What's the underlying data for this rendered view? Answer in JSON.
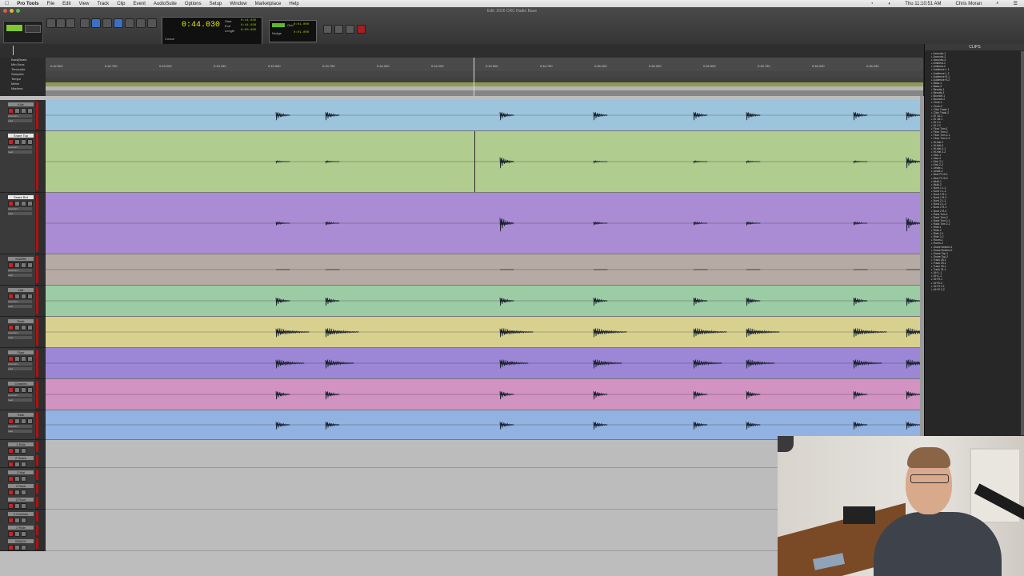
{
  "menubar": {
    "apple": "",
    "items": [
      "Pro Tools",
      "File",
      "Edit",
      "View",
      "Track",
      "Clip",
      "Event",
      "AudioSuite",
      "Options",
      "Setup",
      "Window",
      "Marketplace",
      "Help"
    ],
    "clock": "Thu 11:10:51 AM",
    "user": "Chris Moran"
  },
  "window": {
    "title": "Edit: 2016 CRC Radio Base"
  },
  "counter": {
    "main": "0:44.030",
    "label": "Cursor",
    "start": "0:44.030",
    "end": "0:44.030",
    "length": "0:00.000",
    "start_lbl": "Start",
    "end_lbl": "End",
    "length_lbl": "Length"
  },
  "grid": {
    "grid_lbl": "Grid",
    "nudge_lbl": "Nudge",
    "grid_val": "0:01.000",
    "nudge_val": "0:01.000"
  },
  "ruler_labels": [
    "Bars|Beats",
    "Min:Secs",
    "Timecode",
    "Samples",
    "Tempo",
    "Meter",
    "Markers"
  ],
  "ruler_ticks": [
    "0:42.500",
    "0:42.750",
    "0:43.000",
    "0:43.250",
    "0:43.500",
    "0:43.750",
    "0:44.000",
    "0:44.250",
    "0:44.500",
    "0:44.750",
    "0:45.000",
    "0:45.250",
    "0:45.500",
    "0:45.750",
    "0:46.000",
    "0:46.250"
  ],
  "tracks": [
    {
      "name": "Kick",
      "color": "#9cc4dc"
    },
    {
      "name": "Snare Top",
      "color": "#b0cc8e"
    },
    {
      "name": "Snare Bot",
      "color": "#aa8cd4"
    },
    {
      "name": "SNARE",
      "color": "#b6aba4"
    },
    {
      "name": "Hat",
      "color": "#9ccca4"
    },
    {
      "name": "Rack",
      "color": "#d8d08e"
    },
    {
      "name": "Floor",
      "color": "#9c86d6"
    },
    {
      "name": "Crashes",
      "color": "#d292c2"
    },
    {
      "name": "Ride",
      "color": "#92b2e2"
    }
  ],
  "aux_tracks": [
    "2 Kick",
    "2 Snare",
    "2 Hat",
    "2 Rack",
    "2 Floor",
    "2 Crashes",
    "2 Ride",
    "SMACK"
  ],
  "header_labels": {
    "waveform": "waveform",
    "dyn": "dyn",
    "read": "read"
  },
  "clips": {
    "title": "CLIPS",
    "items": [
      "Acoustic-1",
      "Acoustic-2",
      "Acoustic-3",
      "Ambient-1",
      "Ambient-2",
      "Audience L-1",
      "Audience L-2",
      "Audience R-1",
      "Audience R-2",
      "Bass-1",
      "Bass-2",
      "Beauty-1",
      "Beauty-2",
      "Bounce-1",
      "Bounce-2",
      "Choir-1",
      "Choir-2",
      "Click Track-1",
      "Click Track-2",
      "DI 1A-1",
      "DI 1B-1",
      "DI 2-1",
      "DI 2-2",
      "Floor Tom-1",
      "Floor Tom-2",
      "Floor Tom 2-1",
      "Floor Tom 2-2",
      "Hi-Hat-1",
      "Hi-Hat-2",
      "Hi-Hat 2-1",
      "Hi-Hat 2-2",
      "Kick-1",
      "Kick-2",
      "Kick 2-1",
      "Kick 2-2",
      "Leslie-1",
      "Leslie-2",
      "Mod FX B-1",
      "Mod FX B-2",
      "Multi-1",
      "Multi-2",
      "Nord 1 L-1",
      "Nord 1 L-2",
      "Nord 1 R-1",
      "Nord 1 R-2",
      "Nord 2 L-1",
      "Nord 2 L-2",
      "Nord 2 R-1",
      "Nord 2 R-2",
      "Rack Tom-1",
      "Rack Tom-2",
      "Rack Tom 2-1",
      "Rack Tom 2-2",
      "Ride-1",
      "Ride-2",
      "Ride 2-1",
      "Ride 2-2",
      "Room-1",
      "Room-2",
      "Snare Bottom-1",
      "Snare Bottom-2",
      "Snare Top-1",
      "Snare Top-2",
      "Track 28-1",
      "Track 29-1",
      "Track 30-1",
      "Track 31-1",
      "UH L-1",
      "UH L-2",
      "UH R-1",
      "UH R-2",
      "UH R 2-1",
      "UH R 2-2"
    ]
  }
}
